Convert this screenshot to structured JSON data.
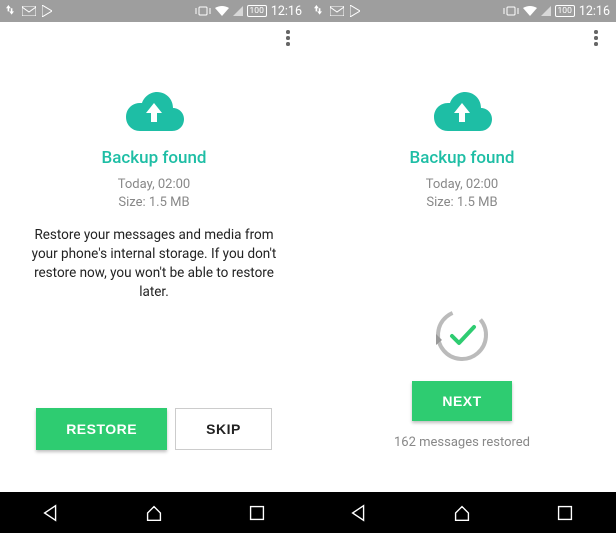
{
  "status": {
    "battery": "100",
    "time": "12:16"
  },
  "left": {
    "title": "Backup found",
    "timestamp": "Today, 02:00",
    "size": "Size: 1.5 MB",
    "description": "Restore your messages and media from your phone's internal storage. If you don't restore now, you won't be able to restore later.",
    "restore_label": "RESTORE",
    "skip_label": "SKIP"
  },
  "right": {
    "title": "Backup found",
    "timestamp": "Today, 02:00",
    "size": "Size: 1.5 MB",
    "next_label": "NEXT",
    "restored_text": "162 messages restored"
  }
}
